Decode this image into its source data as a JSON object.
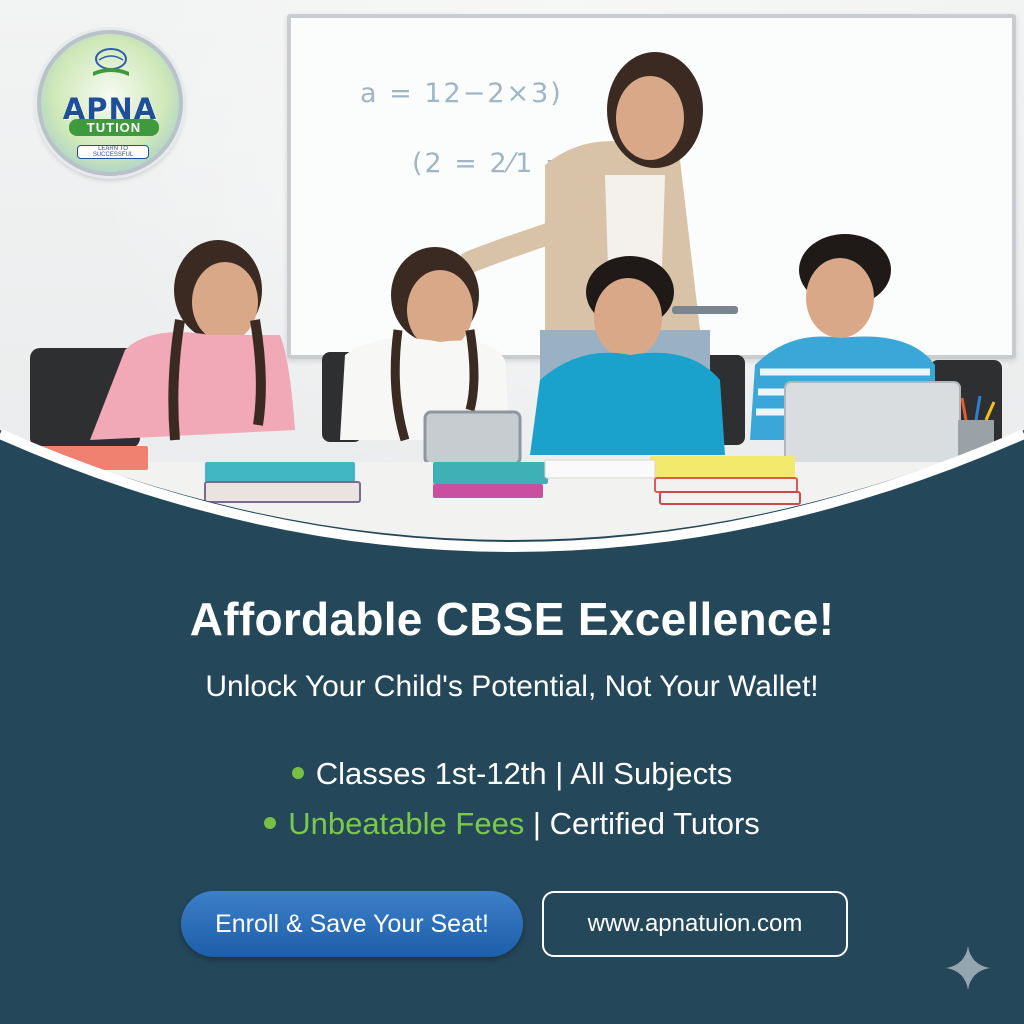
{
  "logo": {
    "brand": "APNA",
    "sub": "TUTION",
    "tagline": "LEARN TO SUCCESSFUL"
  },
  "board": {
    "equation_1": "a = 12−2×3)",
    "equation_2": "(2 = 2⁄1 = (1"
  },
  "headline": "Affordable CBSE Excellence!",
  "subheadline": "Unlock Your Child's Potential, Not Your Wallet!",
  "features": {
    "line1": "Classes 1st-12th | All Subjects",
    "line2_highlight": "Unbeatable Fees",
    "line2_rest": " | Certified Tutors"
  },
  "cta": {
    "enroll_label": "Enroll & Save Your Seat!",
    "website_label": "www.apnatuion.com"
  },
  "colors": {
    "background": "#24475a",
    "accent_green": "#7cc84a",
    "button_blue": "#1d5ea8"
  }
}
